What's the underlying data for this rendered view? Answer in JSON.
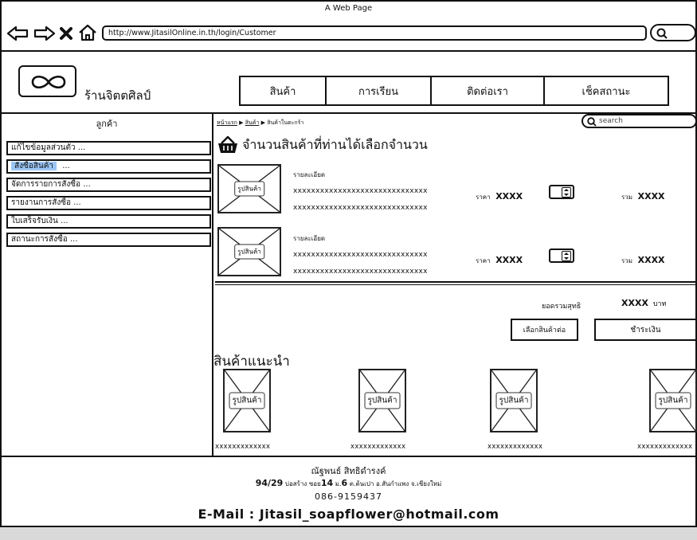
{
  "window": {
    "title": "A Web Page"
  },
  "browser": {
    "url": "http://www.JitasilOnline.in.th/login/Customer"
  },
  "header": {
    "store_name": "ร้านจิตตศิลป์"
  },
  "nav": {
    "tabs": [
      {
        "label": "สินค้า"
      },
      {
        "label": "การเรียน"
      },
      {
        "label": "ติดต่อเรา"
      },
      {
        "label": "เช็คสถานะ"
      }
    ]
  },
  "sidebar": {
    "title": "ลูกค้า",
    "items": [
      {
        "label": "แก้ไขข้อมูลส่วนตัว ...",
        "selected": false
      },
      {
        "label": "สั่งซื้อสินค้า",
        "suffix": "...",
        "selected": true
      },
      {
        "label": "จัดการรายการสั่งซื้อ ...",
        "selected": false
      },
      {
        "label": "รายงานการสั่งซื้อ ...",
        "selected": false
      },
      {
        "label": "ใบเสร็จรับเงิน ...",
        "selected": false
      },
      {
        "label": "สถานะการสั่งซื้อ ...",
        "selected": false
      }
    ]
  },
  "breadcrumb": {
    "items": [
      "หน้าแรก",
      "สินค้า",
      "สินค้าในตะกร้า"
    ],
    "separator": "▶"
  },
  "search": {
    "placeholder": "search"
  },
  "cart": {
    "heading": "จำนวนสินค้าที่ท่านได้เลือกจำนวน",
    "items": [
      {
        "image_label": "รูปสินค้า",
        "detail_label": "รายละเอียด",
        "line1": "xxxxxxxxxxxxxxxxxxxxxxxxxxxxxx",
        "line2": "xxxxxxxxxxxxxxxxxxxxxxxxxxxxxx",
        "price_label": "ราคา",
        "price": "XXXX",
        "total_label": "รวม",
        "total": "XXXX"
      },
      {
        "image_label": "รูปสินค้า",
        "detail_label": "รายละเอียด",
        "line1": "xxxxxxxxxxxxxxxxxxxxxxxxxxxxxx",
        "line2": "xxxxxxxxxxxxxxxxxxxxxxxxxxxxxx",
        "price_label": "ราคา",
        "price": "XXXX",
        "total_label": "รวม",
        "total": "XXXX"
      }
    ],
    "net_total_label": "ยอดรวมสุทธิ",
    "net_total_value": "XXXX",
    "currency": "บาท",
    "continue_button": "เลือกสินค้าต่อ",
    "pay_button": "ชำระเงิน"
  },
  "recommended": {
    "heading": "สินค้าแนะนำ",
    "items": [
      {
        "image_label": "รูปสินค้า",
        "caption": "xxxxxxxxxxxxx"
      },
      {
        "image_label": "รูปสินค้า",
        "caption": "xxxxxxxxxxxxx"
      },
      {
        "image_label": "รูปสินค้า",
        "caption": "xxxxxxxxxxxxx"
      },
      {
        "image_label": "รูปสินค้า",
        "caption": "xxxxxxxxxxxxx"
      }
    ]
  },
  "footer": {
    "name": "ณัฐพนธ์ สิทธิดำรงค์",
    "address_no": "94/29",
    "address_a": "บ่อสร้าง ซอย",
    "soi": "14",
    "moo_label": "ม.",
    "moo": "6",
    "address_b": "ต.ต้นเปา อ.สันกำแพง จ.เชียงใหม่",
    "phone": "086-9159437",
    "email_line": "E-Mail : Jitasil_soapflower@hotmail.com"
  },
  "icons": {
    "back": "back-arrow-icon",
    "forward": "forward-arrow-icon",
    "stop": "close-x-icon",
    "home": "home-icon",
    "search": "search-icon",
    "logo": "infinity-logo-icon",
    "basket": "basket-icon",
    "stepper": "stepper-icon"
  }
}
